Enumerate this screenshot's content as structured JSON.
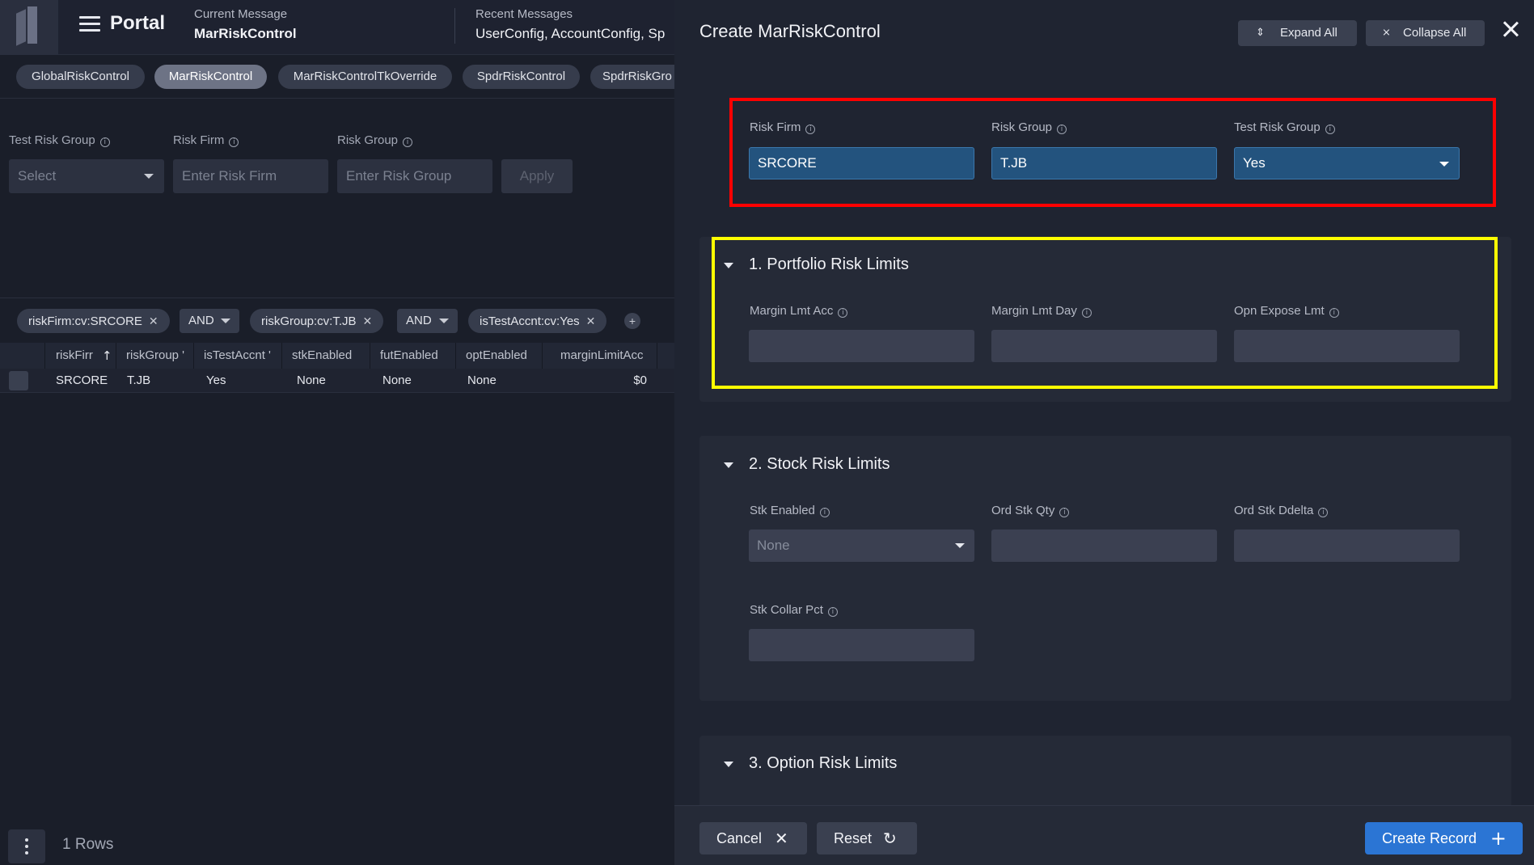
{
  "app": {
    "title": "Portal",
    "current_message_label": "Current Message",
    "current_message_value": "MarRiskControl",
    "recent_messages_label": "Recent Messages",
    "recent_messages_value": "UserConfig, AccountConfig, Sp"
  },
  "tabs": [
    {
      "label": "GlobalRiskControl",
      "active": false
    },
    {
      "label": "MarRiskControl",
      "active": true
    },
    {
      "label": "MarRiskControlTkOverride",
      "active": false
    },
    {
      "label": "SpdrRiskControl",
      "active": false
    },
    {
      "label": "SpdrRiskGro",
      "active": false
    }
  ],
  "filters": {
    "test_risk_group_label": "Test Risk Group",
    "test_risk_group_placeholder": "Select",
    "risk_firm_label": "Risk Firm",
    "risk_firm_placeholder": "Enter Risk Firm",
    "risk_group_label": "Risk Group",
    "risk_group_placeholder": "Enter Risk Group",
    "apply_label": "Apply"
  },
  "query_chips": [
    {
      "label": "riskFirm:cv:SRCORE"
    },
    {
      "operator": "AND"
    },
    {
      "label": "riskGroup:cv:T.JB"
    },
    {
      "operator": "AND"
    },
    {
      "label": "isTestAccnt:cv:Yes"
    }
  ],
  "grid": {
    "columns": [
      "riskFirr",
      "riskGroup '",
      "isTestAccnt '",
      "stkEnabled",
      "futEnabled",
      "optEnabled",
      "marginLimitAcc"
    ],
    "sort_icon": "arrow-up-icon",
    "rows": [
      [
        "SRCORE",
        "T.JB",
        "Yes",
        "None",
        "None",
        "None",
        "$0"
      ]
    ],
    "row_count": "1 Rows"
  },
  "panel": {
    "title": "Create MarRiskControl",
    "expand_all": "Expand All",
    "collapse_all": "Collapse All",
    "key_fields": {
      "risk_firm_label": "Risk Firm",
      "risk_firm_value": "SRCORE",
      "risk_group_label": "Risk Group",
      "risk_group_value": "T.JB",
      "test_risk_group_label": "Test Risk Group",
      "test_risk_group_value": "Yes"
    },
    "sections": [
      {
        "title": "1. Portfolio Risk Limits",
        "fields": [
          "Margin Lmt Acc",
          "Margin Lmt Day",
          "Opn Expose Lmt"
        ]
      },
      {
        "title": "2. Stock Risk Limits",
        "fields": [
          "Stk Enabled",
          "Ord Stk Qty",
          "Ord Stk Ddelta",
          "Stk Collar Pct"
        ],
        "stk_enabled_value": "None"
      },
      {
        "title": "3. Option Risk Limits",
        "fields": []
      }
    ],
    "footer": {
      "cancel": "Cancel",
      "reset": "Reset",
      "create": "Create Record"
    }
  },
  "colors": {
    "highlight_red": "#ff0000",
    "highlight_yellow": "#ffff00",
    "primary_blue": "#2b75d4"
  }
}
